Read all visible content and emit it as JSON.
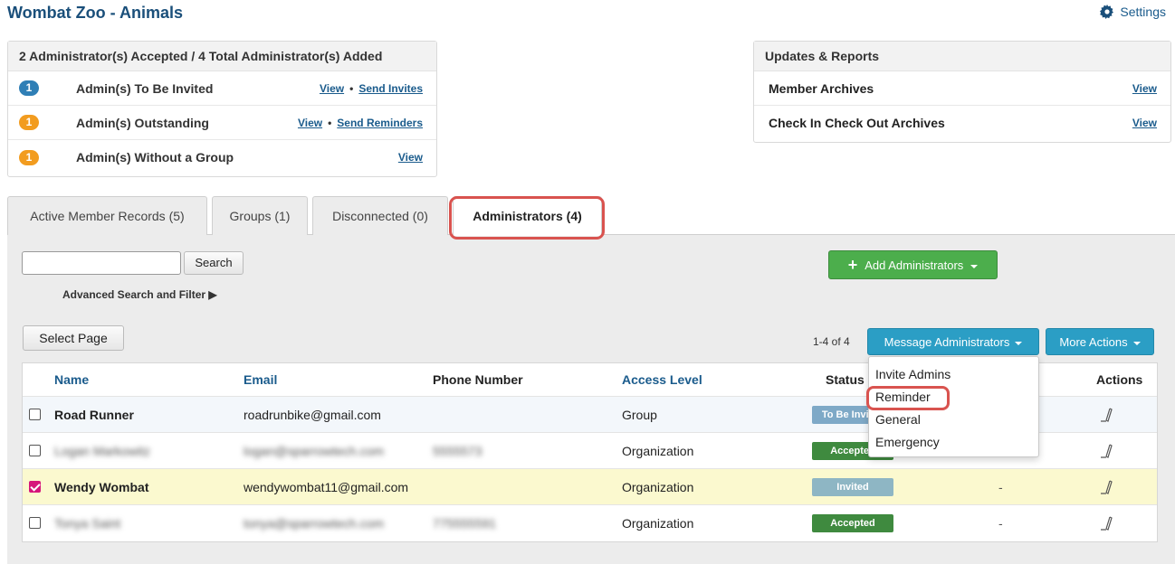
{
  "header": {
    "title": "Wombat Zoo - Animals",
    "settings_label": "Settings"
  },
  "admin_summary": {
    "heading": "2 Administrator(s) Accepted / 4 Total Administrator(s) Added",
    "rows": [
      {
        "count": "1",
        "label": "Admin(s) To Be Invited",
        "view": "View",
        "action": "Send Invites"
      },
      {
        "count": "1",
        "label": "Admin(s) Outstanding",
        "view": "View",
        "action": "Send Reminders"
      },
      {
        "count": "1",
        "label": "Admin(s) Without a Group",
        "view": "View"
      }
    ],
    "separator": "•"
  },
  "reports": {
    "heading": "Updates & Reports",
    "rows": [
      {
        "label": "Member Archives",
        "view": "View"
      },
      {
        "label": "Check In Check Out Archives",
        "view": "View"
      }
    ]
  },
  "tabs": [
    {
      "label": "Active Member Records (5)"
    },
    {
      "label": "Groups (1)"
    },
    {
      "label": "Disconnected (0)"
    },
    {
      "label": "Administrators (4)",
      "active": true
    }
  ],
  "toolbar": {
    "search_value": "",
    "search_button": "Search",
    "advanced_search": "Advanced Search and Filter ▶",
    "add_admins": "Add Administrators",
    "select_page": "Select Page",
    "pager": "1-4 of 4",
    "message_admins": "Message Administrators",
    "more_actions": "More Actions"
  },
  "table": {
    "headers": {
      "name": "Name",
      "email": "Email",
      "phone": "Phone Number",
      "access": "Access Level",
      "status": "Status",
      "actions": "Actions"
    },
    "rows": [
      {
        "name": "Road Runner",
        "email": "roadrunbike@gmail.com",
        "phone": "",
        "access": "Group",
        "status": "To Be Invited",
        "last": "",
        "checked": false
      },
      {
        "name": "Logan Markowitz",
        "email": "logan@sparrowtech.com",
        "phone": "5555573",
        "access": "Organization",
        "status": "Accepted",
        "last": "",
        "checked": false
      },
      {
        "name": "Wendy Wombat",
        "email": "wendywombat11@gmail.com",
        "phone": "",
        "access": "Organization",
        "status": "Invited",
        "last": "-",
        "checked": true
      },
      {
        "name": "Tonya Saint",
        "email": "tonya@sparrowtech.com",
        "phone": "775555591",
        "access": "Organization",
        "status": "Accepted",
        "last": "-",
        "checked": false
      }
    ]
  },
  "message_menu": {
    "items": [
      "Invite Admins",
      "Reminder",
      "General",
      "Emergency"
    ]
  },
  "colors": {
    "title": "#1a4f7a",
    "link": "#1a5b8c",
    "highlight_ring": "#d9534f",
    "green_button": "#4cae4c",
    "blue_button": "#2b9ec5",
    "selected_row": "#fbf9cf",
    "checkbox_checked": "#d6157b"
  },
  "icons": [
    "gear-icon",
    "plus-icon",
    "caret-down-icon",
    "pencil-icon",
    "checkbox-icon"
  ]
}
